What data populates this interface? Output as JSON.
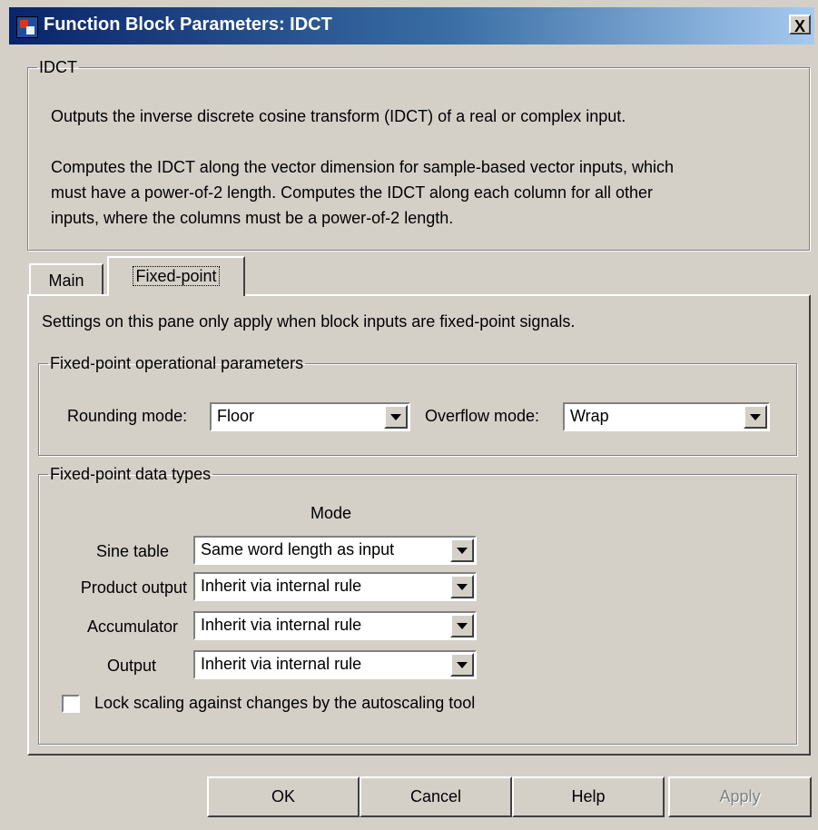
{
  "window": {
    "title": "Function Block Parameters: IDCT",
    "close_label": "X"
  },
  "description_group": {
    "legend": "IDCT",
    "line1": "Outputs the inverse discrete cosine transform (IDCT) of a real or complex input.",
    "para2_line1": "Computes the IDCT along the vector dimension for sample-based vector inputs, which",
    "para2_line2": "must have a power-of-2 length. Computes the IDCT along each column for all other",
    "para2_line3": "inputs, where the columns must be a power-of-2 length."
  },
  "tabs": [
    {
      "label": "Main",
      "active": false
    },
    {
      "label": "Fixed-point",
      "active": true
    }
  ],
  "fixed_point_pane": {
    "note": "Settings on this pane only apply when block inputs are fixed-point signals.",
    "operational": {
      "legend": "Fixed-point operational parameters",
      "rounding_label": "Rounding mode:",
      "rounding_value": "Floor",
      "overflow_label": "Overflow mode:",
      "overflow_value": "Wrap"
    },
    "data_types": {
      "legend": "Fixed-point data types",
      "mode_header": "Mode",
      "rows": [
        {
          "label": "Sine table",
          "value": "Same word length as input"
        },
        {
          "label": "Product output",
          "value": "Inherit via internal rule"
        },
        {
          "label": "Accumulator",
          "value": "Inherit via internal rule"
        },
        {
          "label": "Output",
          "value": "Inherit via internal rule"
        }
      ],
      "lock_scaling_label": "Lock scaling against changes by the autoscaling tool",
      "lock_scaling_checked": false
    }
  },
  "buttons": {
    "ok": "OK",
    "cancel": "Cancel",
    "help": "Help",
    "apply": "Apply"
  }
}
